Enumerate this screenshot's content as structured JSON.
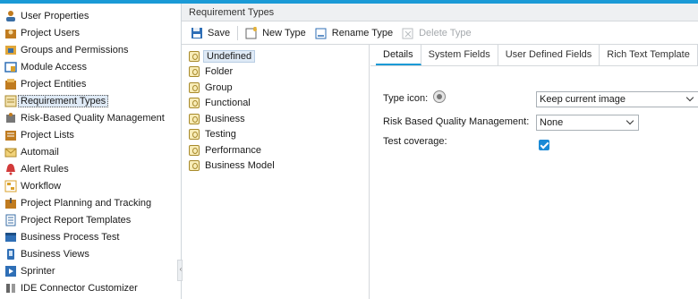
{
  "nav": {
    "items": [
      {
        "label": "User Properties",
        "icon": "user-properties-icon",
        "color": "#3a6ea5"
      },
      {
        "label": "Project Users",
        "icon": "project-users-icon",
        "color": "#c07b1f"
      },
      {
        "label": "Groups and Permissions",
        "icon": "groups-permissions-icon",
        "color": "#c07b1f"
      },
      {
        "label": "Module Access",
        "icon": "module-access-icon",
        "color": "#2f6fb6"
      },
      {
        "label": "Project Entities",
        "icon": "project-entities-icon",
        "color": "#c07b1f"
      },
      {
        "label": "Requirement Types",
        "icon": "requirement-types-icon",
        "color": "#c07b1f",
        "selected": true
      },
      {
        "label": "Risk-Based Quality Management",
        "icon": "risk-quality-icon",
        "color": "#555555"
      },
      {
        "label": "Project Lists",
        "icon": "project-lists-icon",
        "color": "#c07b1f"
      },
      {
        "label": "Automail",
        "icon": "automail-icon",
        "color": "#d9a02a"
      },
      {
        "label": "Alert Rules",
        "icon": "alert-rules-icon",
        "color": "#d23a3a"
      },
      {
        "label": "Workflow",
        "icon": "workflow-icon",
        "color": "#d9a02a"
      },
      {
        "label": "Project Planning and Tracking",
        "icon": "planning-tracking-icon",
        "color": "#c07b1f"
      },
      {
        "label": "Project Report Templates",
        "icon": "report-templates-icon",
        "color": "#3a6ea5"
      },
      {
        "label": "Business Process Test",
        "icon": "business-process-test-icon",
        "color": "#2f6fb6"
      },
      {
        "label": "Business Views",
        "icon": "business-views-icon",
        "color": "#2f6fb6"
      },
      {
        "label": "Sprinter",
        "icon": "sprinter-icon",
        "color": "#2f6fb6"
      },
      {
        "label": "IDE Connector Customizer",
        "icon": "ide-connector-icon",
        "color": "#555555"
      }
    ]
  },
  "main": {
    "title": "Requirement Types",
    "toolbar": {
      "save_label": "Save",
      "new_type_label": "New Type",
      "rename_type_label": "Rename Type",
      "delete_type_label": "Delete Type"
    },
    "types": [
      {
        "label": "Undefined",
        "selected": true
      },
      {
        "label": "Folder"
      },
      {
        "label": "Group"
      },
      {
        "label": "Functional"
      },
      {
        "label": "Business"
      },
      {
        "label": "Testing"
      },
      {
        "label": "Performance"
      },
      {
        "label": "Business Model"
      }
    ],
    "tabs": [
      "Details",
      "System Fields",
      "User Defined Fields",
      "Rich Text Template"
    ],
    "active_tab": "Details",
    "form": {
      "type_icon_label": "Type icon:",
      "type_icon_select": "Keep current image",
      "rbqm_label": "Risk Based Quality Management:",
      "rbqm_select": "None",
      "test_coverage_label": "Test coverage:",
      "test_coverage_checked": true
    }
  },
  "colors": {
    "accent": "#1a9ad6",
    "selection": "#dfeaf6"
  }
}
